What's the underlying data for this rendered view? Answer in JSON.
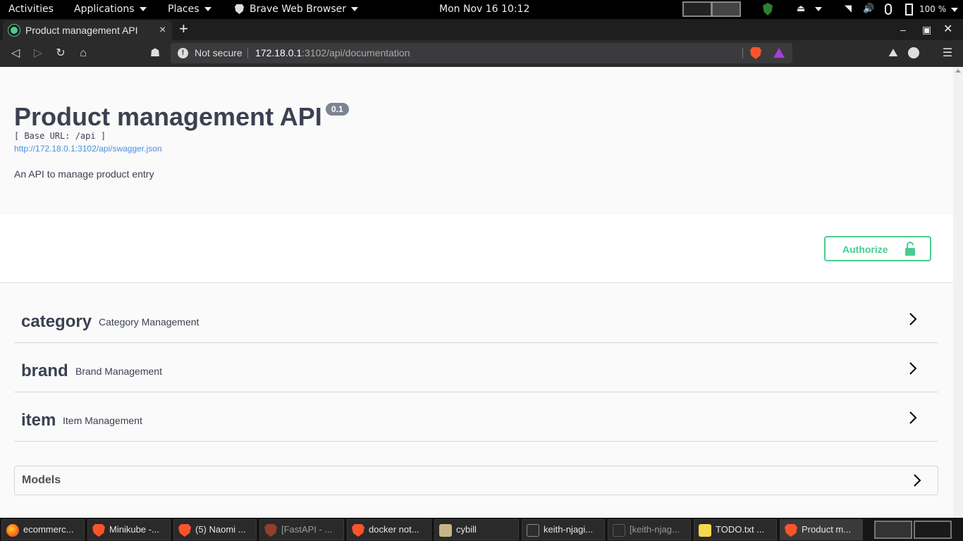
{
  "system": {
    "activities": "Activities",
    "applications": "Applications",
    "places": "Places",
    "active_app": "Brave Web Browser",
    "clock": "Mon Nov 16  10:12",
    "battery": "100 %"
  },
  "browser": {
    "tab_title": "Product management API",
    "tab_close": "×",
    "new_tab": "+",
    "not_secure": "Not secure",
    "url_host": "172.18.0.1",
    "url_path": ":3102/api/documentation"
  },
  "page": {
    "title": "Product management API",
    "version": "0.1",
    "base_url": "[ Base URL: /api ]",
    "spec_link": "http://172.18.0.1:3102/api/swagger.json",
    "description": "An API to manage product entry",
    "authorize_label": "Authorize",
    "tags": [
      {
        "name": "category",
        "description": "Category Management"
      },
      {
        "name": "brand",
        "description": "Brand Management"
      },
      {
        "name": "item",
        "description": "Item Management"
      }
    ],
    "models_label": "Models"
  },
  "colors": {
    "authorize_green": "#49cc90",
    "text": "#3b4151",
    "link": "#4990e2"
  },
  "taskbar": [
    {
      "label": "ecommerc...",
      "icon": "firefox-icon"
    },
    {
      "label": "Minikube -...",
      "icon": "brave-icon"
    },
    {
      "label": "(5) Naomi ...",
      "icon": "brave-icon"
    },
    {
      "label": "[FastAPI - ...",
      "icon": "brave-icon"
    },
    {
      "label": "docker not...",
      "icon": "brave-icon"
    },
    {
      "label": "cybill",
      "icon": "files-icon"
    },
    {
      "label": "keith-njagi...",
      "icon": "terminal-icon"
    },
    {
      "label": "[keith-njag...",
      "icon": "terminal-icon"
    },
    {
      "label": "TODO.txt ...",
      "icon": "text-editor-icon"
    },
    {
      "label": "Product m...",
      "icon": "brave-icon"
    }
  ]
}
